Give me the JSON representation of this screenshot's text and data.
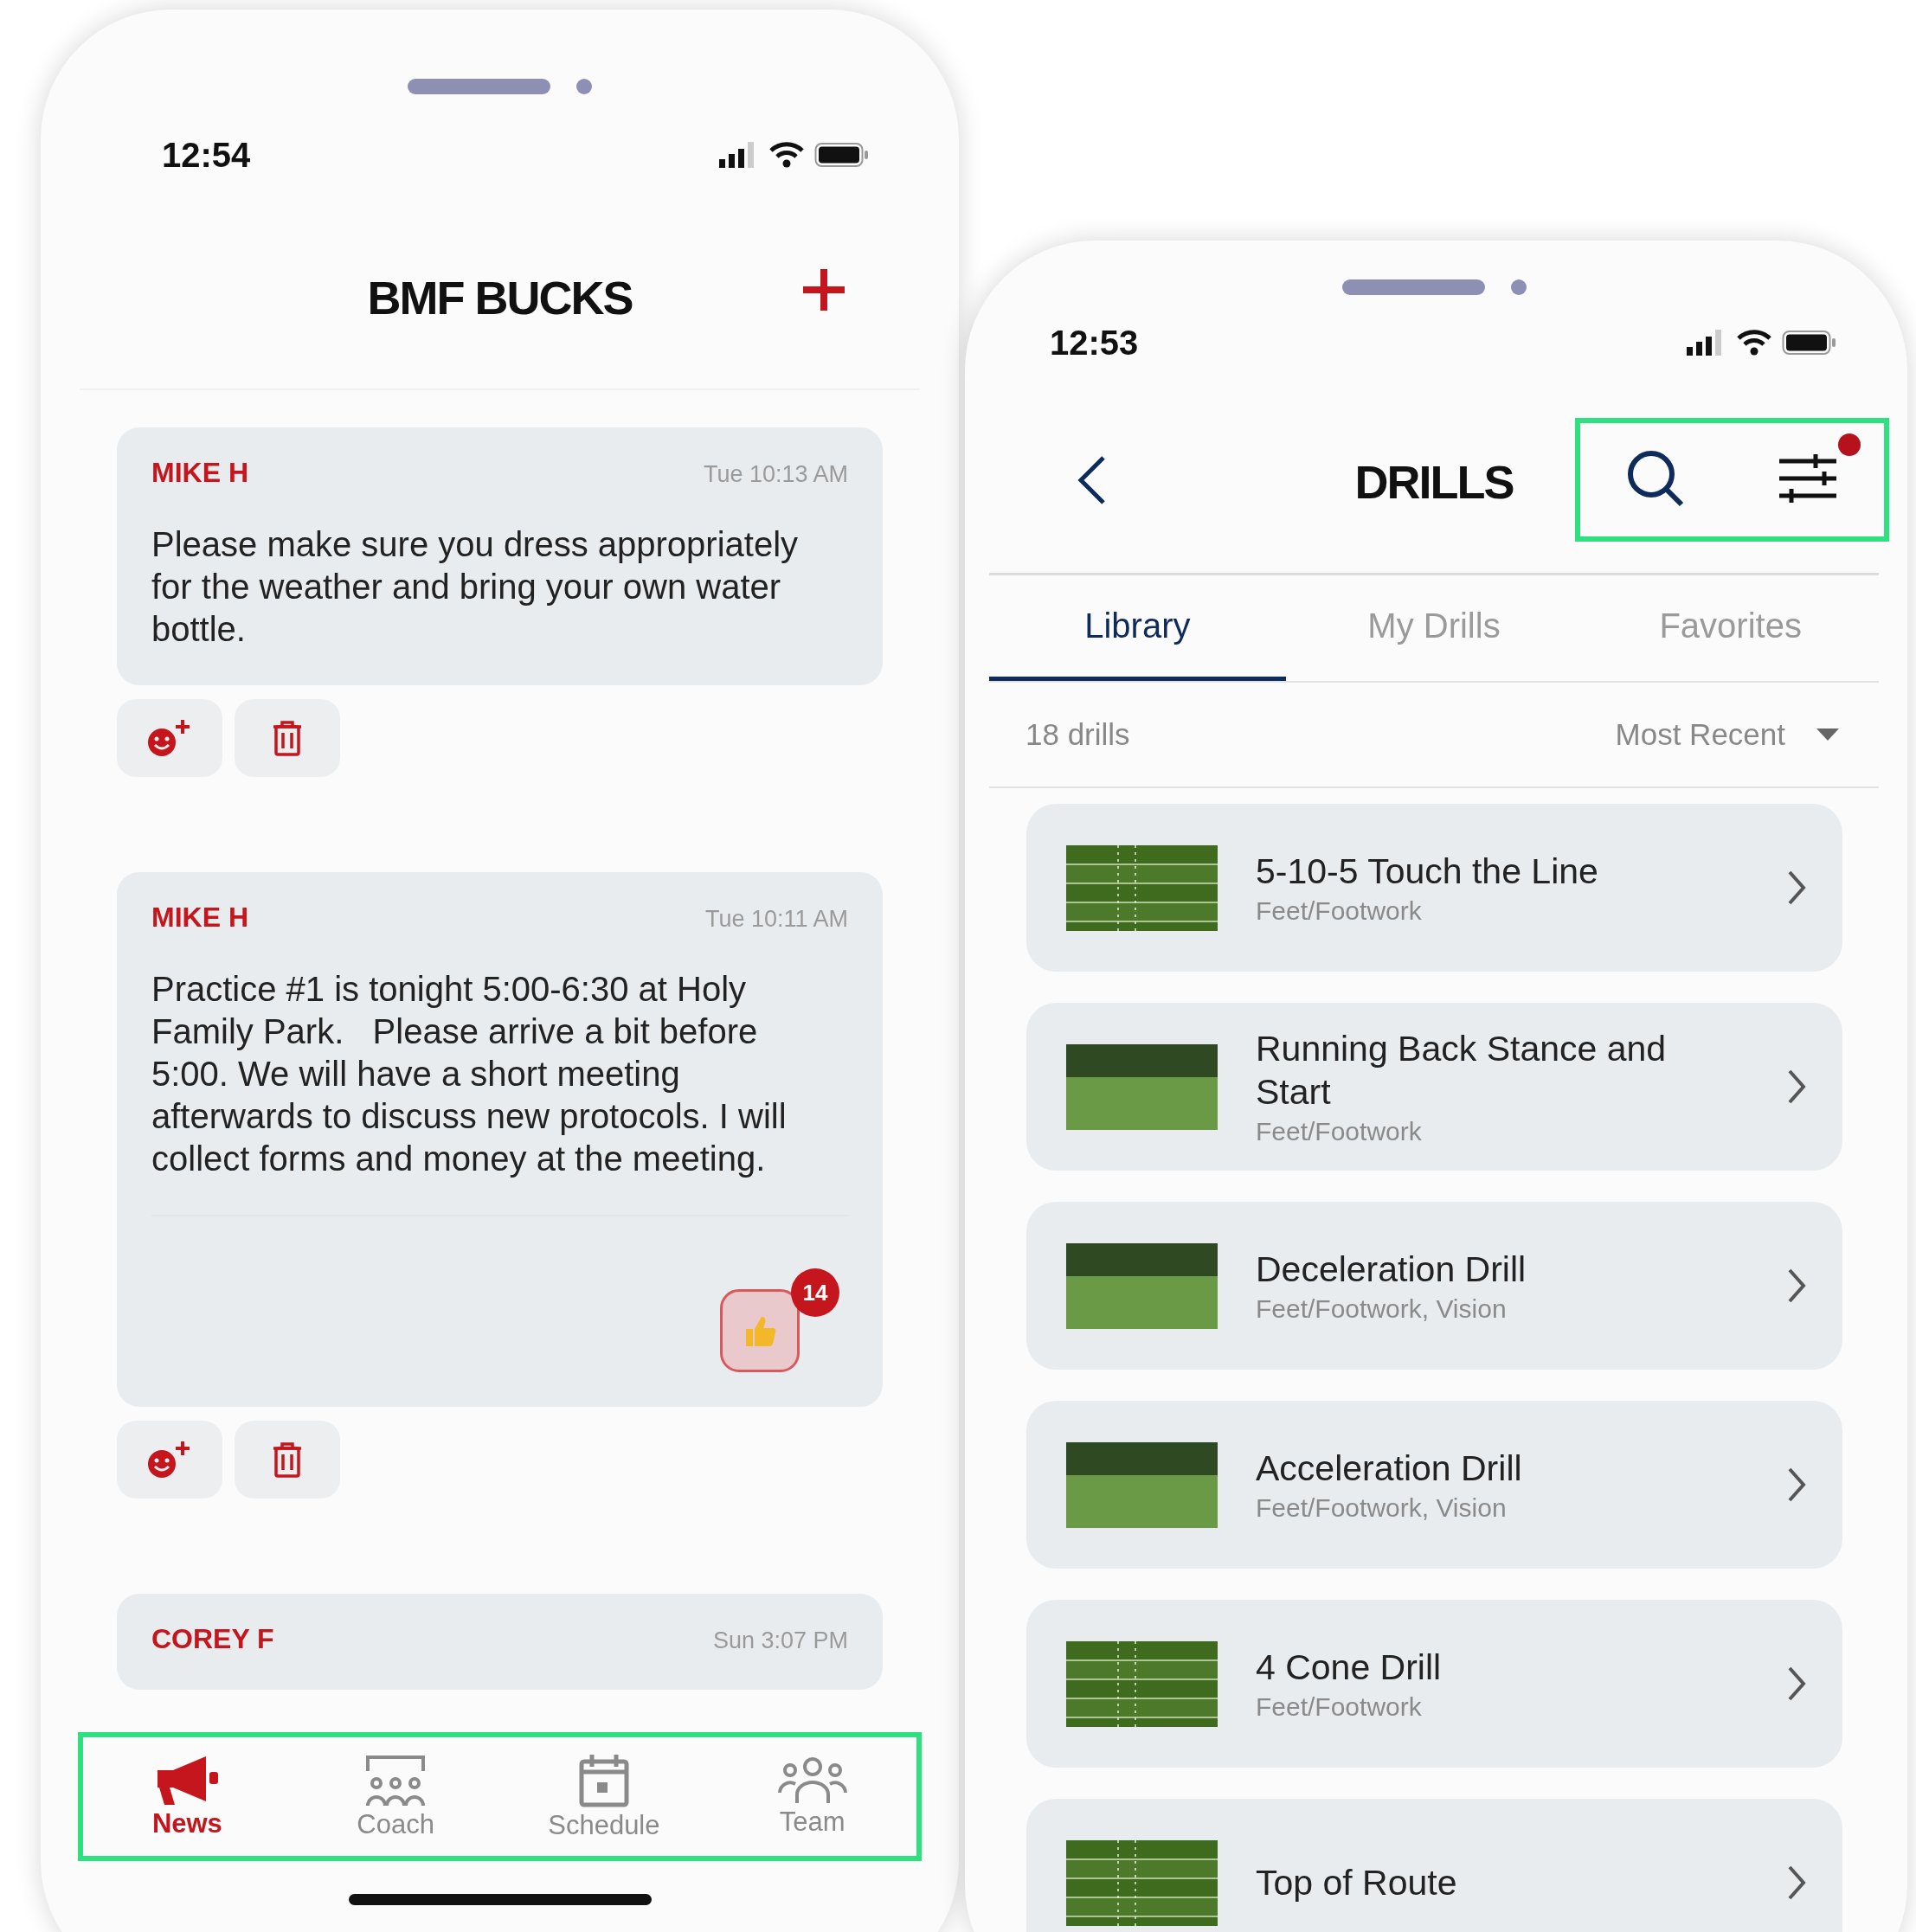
{
  "left_phone": {
    "status_bar": {
      "time": "12:54"
    },
    "header": {
      "title": "BMF BUCKS"
    },
    "posts": [
      {
        "author": "MIKE H",
        "time": "Tue 10:13 AM",
        "body": "Please make sure you dress appropriately for the weather and bring your own water bottle."
      },
      {
        "author": "MIKE H",
        "time": "Tue 10:11 AM",
        "body": "Practice #1 is tonight 5:00-6:30 at Holy Family Park.   Please arrive a bit before 5:00. We will have a short meeting afterwards to discuss new protocols. I will collect forms and money at the meeting.",
        "reaction": {
          "count": "14",
          "selected": true
        }
      },
      {
        "author": "COREY F",
        "time": "Sun 3:07 PM"
      }
    ],
    "bottom_nav": {
      "highlighted": true,
      "items": [
        {
          "label": "News",
          "kind": "megaphone",
          "selected": true
        },
        {
          "label": "Coach",
          "kind": "coach",
          "selected": false
        },
        {
          "label": "Schedule",
          "kind": "calendar",
          "selected": false
        },
        {
          "label": "Team",
          "kind": "team",
          "selected": false
        }
      ]
    }
  },
  "right_phone": {
    "status_bar": {
      "time": "12:53"
    },
    "header": {
      "title": "DRILLS",
      "actions_highlighted": true,
      "filter_active": true
    },
    "tabs": [
      {
        "label": "Library",
        "selected": true
      },
      {
        "label": "My Drills",
        "selected": false
      },
      {
        "label": "Favorites",
        "selected": false
      }
    ],
    "count": "18 drills",
    "sort": "Most Recent",
    "drills": [
      {
        "title": "5-10-5 Touch the Line",
        "category": "Feet/Footwork",
        "kind": "field"
      },
      {
        "title": "Running Back Stance and Start",
        "category": "Feet/Footwork",
        "kind": "photo"
      },
      {
        "title": "Deceleration Drill",
        "category": "Feet/Footwork, Vision",
        "kind": "photo"
      },
      {
        "title": "Acceleration Drill",
        "category": "Feet/Footwork, Vision",
        "kind": "photo"
      },
      {
        "title": "4 Cone Drill",
        "category": "Feet/Footwork",
        "kind": "field"
      },
      {
        "title": "Top of Route",
        "kind": "field"
      }
    ]
  }
}
